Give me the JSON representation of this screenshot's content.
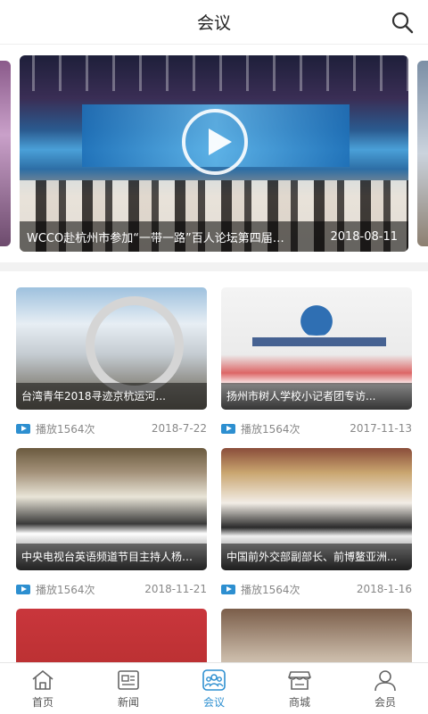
{
  "header": {
    "title": "会议",
    "search_icon": "search-icon"
  },
  "banner": {
    "title": "WCCO赴杭州市参加“一带一路”百人论坛第四届年会...",
    "date": "2018-08-11"
  },
  "videos": [
    {
      "title": "台湾青年2018寻迹京杭运河...",
      "plays": "播放1564次",
      "date": "2018-7-22"
    },
    {
      "title": "扬州市树人学校小记者团专访...",
      "plays": "播放1564次",
      "date": "2017-11-13"
    },
    {
      "title": "中央电视台英语频道节目主持人杨锐...",
      "plays": "播放1564次",
      "date": "2018-11-21"
    },
    {
      "title": "中国前外交部副部长、前博鳌亚洲...",
      "plays": "播放1564次",
      "date": "2018-1-16"
    },
    {
      "title": "",
      "plays": "",
      "date": ""
    },
    {
      "title": "",
      "plays": "",
      "date": ""
    }
  ],
  "tabbar": [
    {
      "label": "首页",
      "icon": "home-icon"
    },
    {
      "label": "新闻",
      "icon": "news-icon"
    },
    {
      "label": "会议",
      "icon": "meeting-icon",
      "active": true
    },
    {
      "label": "商城",
      "icon": "shop-icon"
    },
    {
      "label": "会员",
      "icon": "user-icon"
    }
  ],
  "colors": {
    "accent": "#2d8fd0",
    "divider": "#f2f2f2"
  }
}
